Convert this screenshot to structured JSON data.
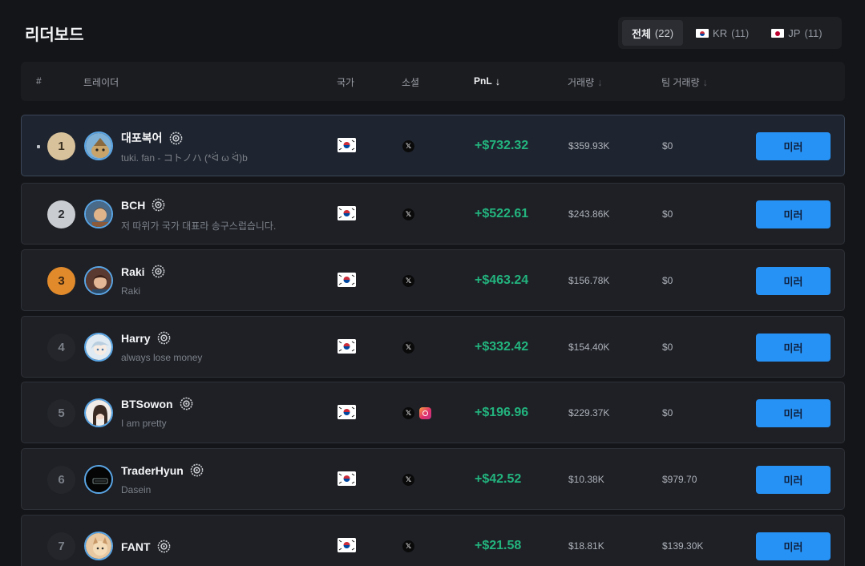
{
  "page": {
    "title": "리더보드"
  },
  "filters": [
    {
      "label": "전체",
      "count": "(22)",
      "flag": "",
      "active": true
    },
    {
      "label": "KR",
      "count": "(11)",
      "flag": "kr",
      "active": false
    },
    {
      "label": "JP",
      "count": "(11)",
      "flag": "jp",
      "active": false
    }
  ],
  "columns": {
    "rank": "#",
    "trader": "트레이더",
    "country": "국가",
    "social": "소셜",
    "pnl": "PnL",
    "volume": "거래량",
    "team_volume": "팀 거래량"
  },
  "colors": {
    "accent": "#2792f5",
    "pnl_positive": "#23b47e",
    "gold": "#d8c29b",
    "silver": "#c9ccd1",
    "bronze": "#e08a2c"
  },
  "rows": [
    {
      "rank": "1",
      "name": "대포복어",
      "bio": "tuki. fan - コトノハ (*ᐛ ω ᐛ)b",
      "country_icon": "korea-flag-icon",
      "socials": [
        "x"
      ],
      "pnl": "+$732.32",
      "volume": "$359.93K",
      "team_volume": "$0",
      "action": "미러"
    },
    {
      "rank": "2",
      "name": "BCH",
      "bio": "저 따위가 국가 대표라 송구스럽습니다.",
      "country_icon": "korea-flag-icon",
      "socials": [
        "x"
      ],
      "pnl": "+$522.61",
      "volume": "$243.86K",
      "team_volume": "$0",
      "action": "미러"
    },
    {
      "rank": "3",
      "name": "Raki",
      "bio": "Raki",
      "country_icon": "korea-flag-icon",
      "socials": [
        "x"
      ],
      "pnl": "+$463.24",
      "volume": "$156.78K",
      "team_volume": "$0",
      "action": "미러"
    },
    {
      "rank": "4",
      "name": "Harry",
      "bio": "always lose money",
      "country_icon": "korea-flag-icon",
      "socials": [
        "x"
      ],
      "pnl": "+$332.42",
      "volume": "$154.40K",
      "team_volume": "$0",
      "action": "미러"
    },
    {
      "rank": "5",
      "name": "BTSowon",
      "bio": "I am pretty",
      "country_icon": "korea-flag-icon",
      "socials": [
        "x",
        "instagram"
      ],
      "pnl": "+$196.96",
      "volume": "$229.37K",
      "team_volume": "$0",
      "action": "미러"
    },
    {
      "rank": "6",
      "name": "TraderHyun",
      "bio": "Dasein",
      "country_icon": "korea-flag-icon",
      "socials": [
        "x"
      ],
      "pnl": "+$42.52",
      "volume": "$10.38K",
      "team_volume": "$979.70",
      "action": "미러"
    },
    {
      "rank": "7",
      "name": "FANT",
      "bio": "",
      "country_icon": "korea-flag-icon",
      "socials": [
        "x"
      ],
      "pnl": "+$21.58",
      "volume": "$18.81K",
      "team_volume": "$139.30K",
      "action": "미러"
    }
  ]
}
